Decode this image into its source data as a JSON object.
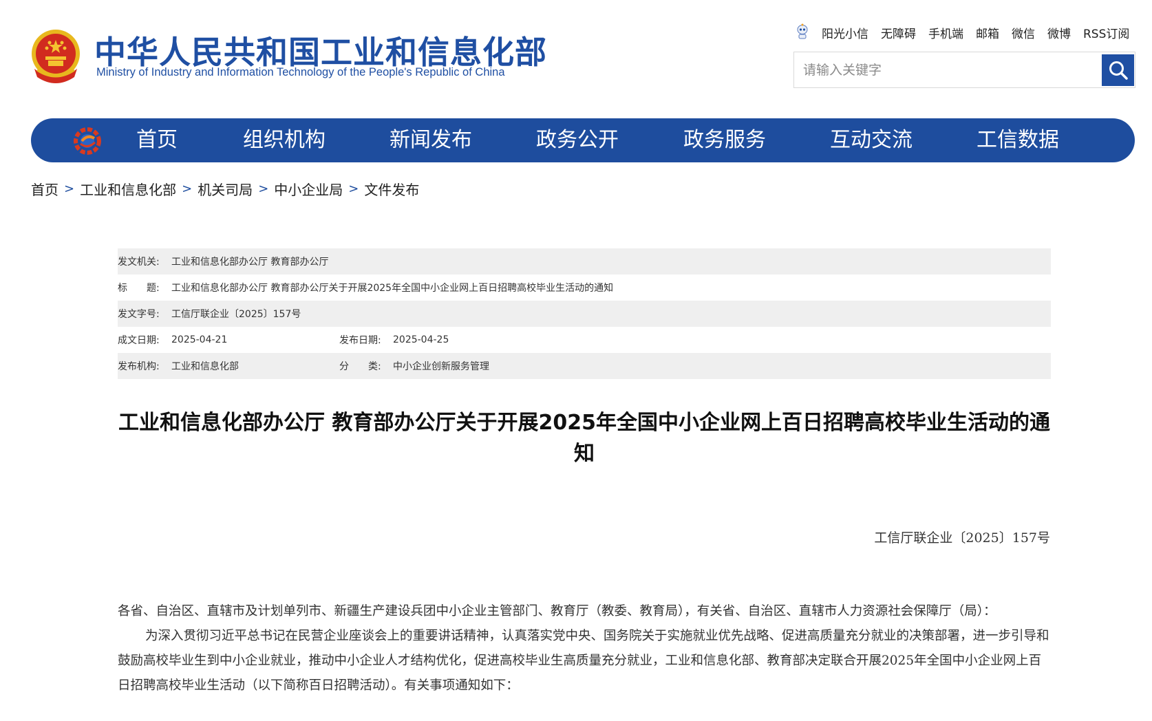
{
  "header": {
    "title_cn": "中华人民共和国工业和信息化部",
    "title_en": "Ministry of Industry and Information Technology of the People's Republic of China",
    "top_links": [
      "阳光小信",
      "无障碍",
      "手机端",
      "邮箱",
      "微信",
      "微博",
      "RSS订阅"
    ],
    "search_placeholder": "请输入关键字"
  },
  "nav": {
    "items": [
      "首页",
      "组织机构",
      "新闻发布",
      "政务公开",
      "政务服务",
      "互动交流",
      "工信数据"
    ]
  },
  "breadcrumb": [
    "首页",
    "工业和信息化部",
    "机关司局",
    "中小企业局",
    "文件发布"
  ],
  "info": {
    "issuer_label": "发文机关:",
    "issuer": "工业和信息化部办公厅 教育部办公厅",
    "title_label": "标　　题:",
    "title": "工业和信息化部办公厅 教育部办公厅关于开展2025年全国中小企业网上百日招聘高校毕业生活动的通知",
    "docno_label": "发文字号:",
    "docno": "工信厅联企业〔2025〕157号",
    "written_label": "成文日期:",
    "written": "2025-04-21",
    "published_label": "发布日期:",
    "published": "2025-04-25",
    "org_label": "发布机构:",
    "org": "工业和信息化部",
    "category_label": "分　　类:",
    "category": "中小企业创新服务管理"
  },
  "article": {
    "title": "工业和信息化部办公厅 教育部办公厅关于开展2025年全国中小企业网上百日招聘高校毕业生活动的通知",
    "doc_number": "工信厅联企业〔2025〕157号",
    "salutation": "各省、自治区、直辖市及计划单列市、新疆生产建设兵团中小企业主管部门、教育厅（教委、教育局），有关省、自治区、直辖市人力资源社会保障厅（局）：",
    "paragraph1": "为深入贯彻习近平总书记在民营企业座谈会上的重要讲话精神，认真落实党中央、国务院关于实施就业优先战略、促进高质量充分就业的决策部署，进一步引导和鼓励高校毕业生到中小企业就业，推动中小企业人才结构优化，促进高校毕业生高质量充分就业，工业和信息化部、教育部决定联合开展2025年全国中小企业网上百日招聘高校毕业生活动（以下简称百日招聘活动）。有关事项通知如下："
  },
  "colors": {
    "brand_blue": "#1e4d9e",
    "shade_gray": "#efefef"
  }
}
